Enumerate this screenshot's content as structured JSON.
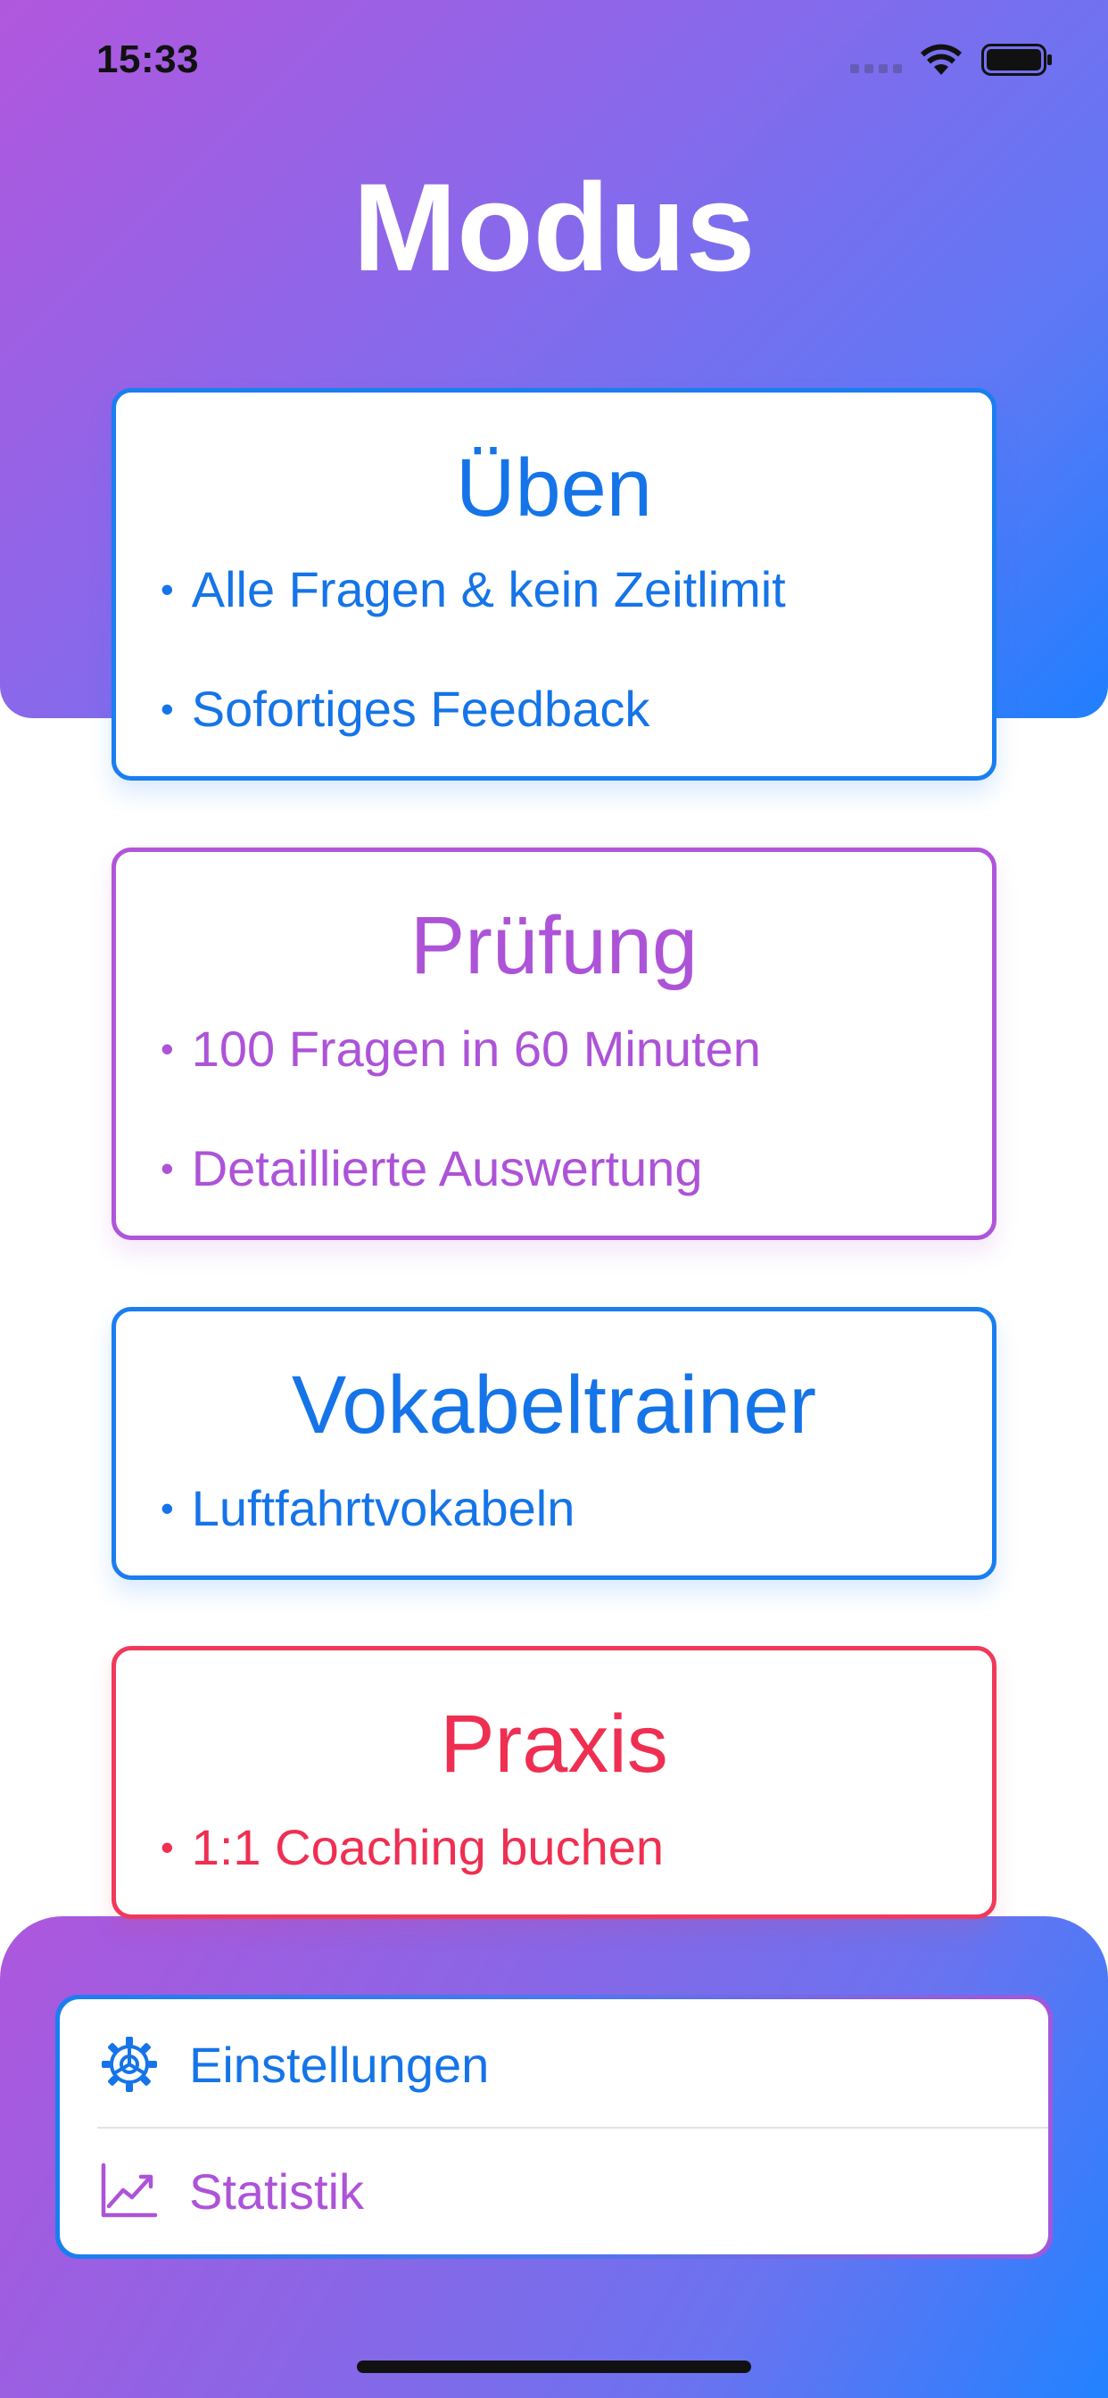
{
  "status_bar": {
    "time": "15:33"
  },
  "title": "Modus",
  "cards": [
    {
      "title": "Üben",
      "bullets": [
        "Alle Fragen & kein Zeitlimit",
        "Sofortiges Feedback"
      ],
      "color": "#1574e8"
    },
    {
      "title": "Prüfung",
      "bullets": [
        "100 Fragen in 60 Minuten",
        "Detaillierte Auswertung"
      ],
      "color": "#ad53d8"
    },
    {
      "title": "Vokabeltrainer",
      "bullets": [
        "Luftfahrtvokabeln"
      ],
      "color": "#1574e8"
    },
    {
      "title": "Praxis",
      "bullets": [
        "1:1 Coaching buchen"
      ],
      "color": "#ef2f52"
    }
  ],
  "bullet_char": "•",
  "menu": {
    "items": [
      {
        "label": "Einstellungen",
        "icon": "gear-icon",
        "color": "#1574e8"
      },
      {
        "label": "Statistik",
        "icon": "chart-icon",
        "color": "#ad53d8"
      }
    ]
  },
  "theme": {
    "gradient_start": "#b157dd",
    "gradient_end": "#1f7fff"
  }
}
